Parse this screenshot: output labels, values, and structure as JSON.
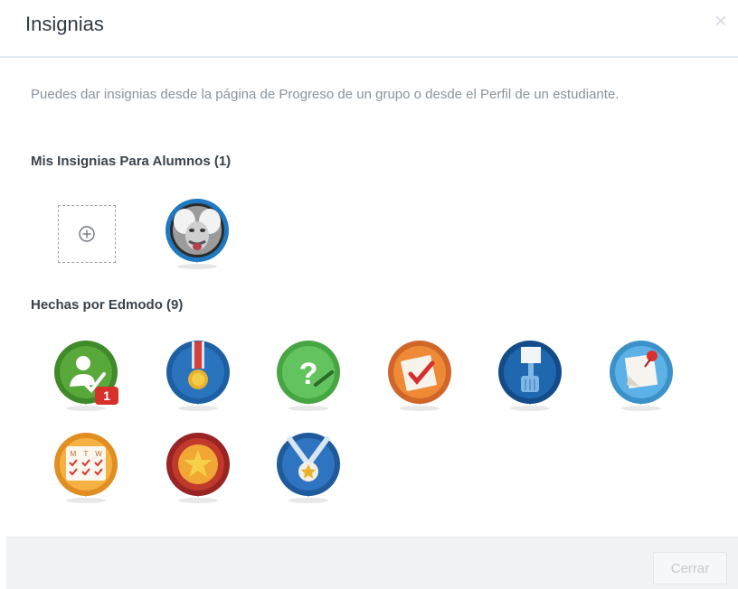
{
  "modal": {
    "title": "Insignias",
    "close_icon": "×",
    "intro": "Puedes dar insignias desde la página de Progreso de un grupo o desde el Perfil de un estudiante.",
    "my_section": {
      "title": "Mis Insignias Para Alumnos (1)"
    },
    "edmodo_section": {
      "title": "Hechas por Edmodo (9)"
    },
    "badges": [
      {
        "icon": "student-check-icon",
        "color": "#58a83a",
        "count": "1"
      },
      {
        "icon": "medal-icon",
        "color": "#1d5fa3"
      },
      {
        "icon": "question-icon",
        "color": "#5cbf58"
      },
      {
        "icon": "checklist-icon",
        "color": "#e07a2e"
      },
      {
        "icon": "raised-hand-icon",
        "color": "#1d5fa3"
      },
      {
        "icon": "pinned-note-icon",
        "color": "#4fa7dc"
      },
      {
        "icon": "calendar-checks-icon",
        "color": "#f0a733"
      },
      {
        "icon": "star-icon",
        "color": "#b32d2d"
      },
      {
        "icon": "star-medal-icon",
        "color": "#2a6db8"
      }
    ],
    "calendar_days": [
      "M",
      "T",
      "W"
    ],
    "footer": {
      "close_label": "Cerrar"
    }
  }
}
